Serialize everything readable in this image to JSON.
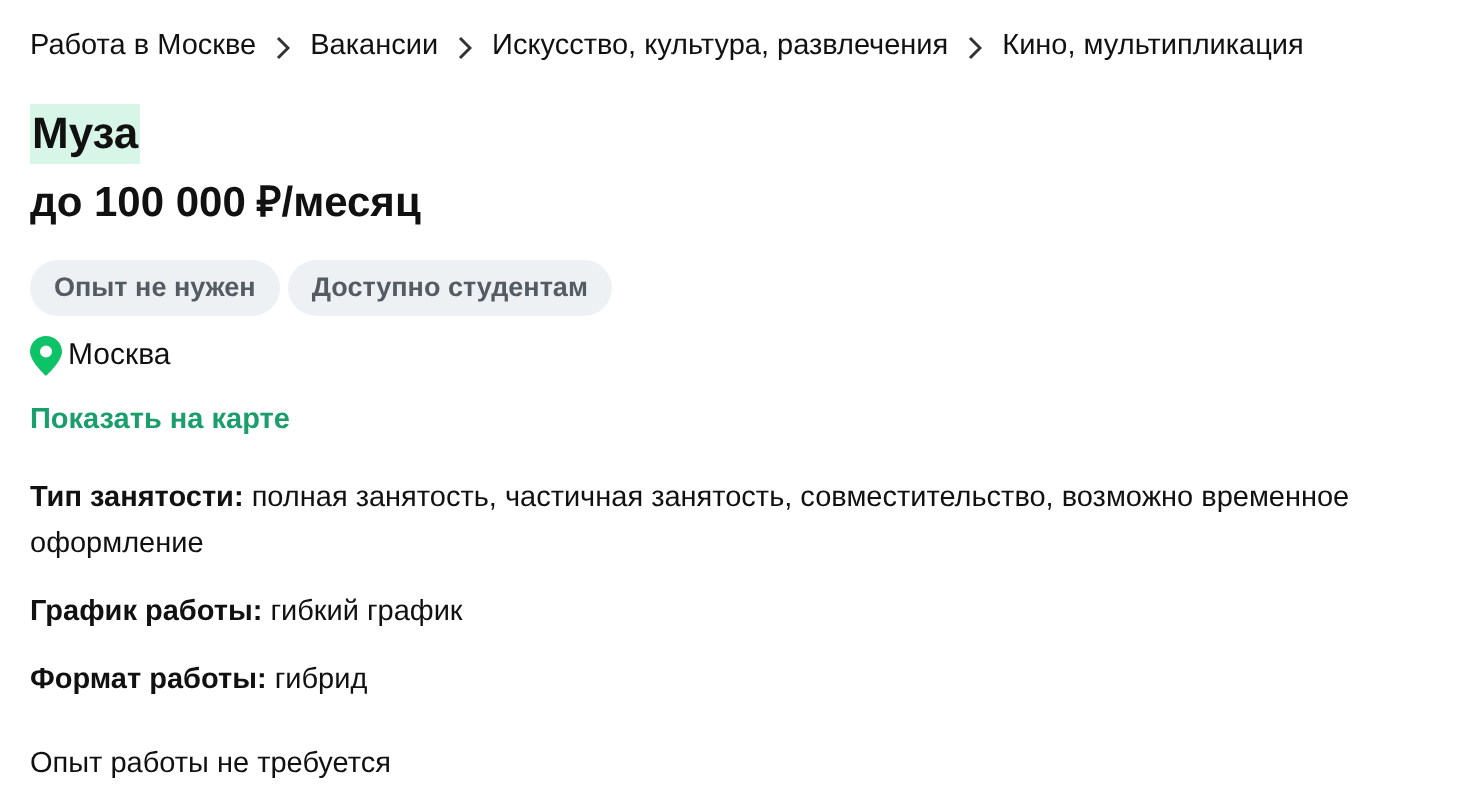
{
  "breadcrumbs": [
    "Работа в Москве",
    "Вакансии",
    "Искусство, культура, развлечения",
    "Кино, мультипликация"
  ],
  "title": "Муза",
  "salary": "до 100 000 ₽/месяц",
  "tags": [
    "Опыт не нужен",
    "Доступно студентам"
  ],
  "location": "Москва",
  "map_link": "Показать на карте",
  "details": [
    {
      "label": "Тип занятости:",
      "value": "полная занятость, частичная занятость, совместительство, возможно временное оформление"
    },
    {
      "label": "График работы:",
      "value": "гибкий график"
    },
    {
      "label": "Формат работы:",
      "value": "гибрид"
    }
  ],
  "experience": "Опыт работы не требуется"
}
